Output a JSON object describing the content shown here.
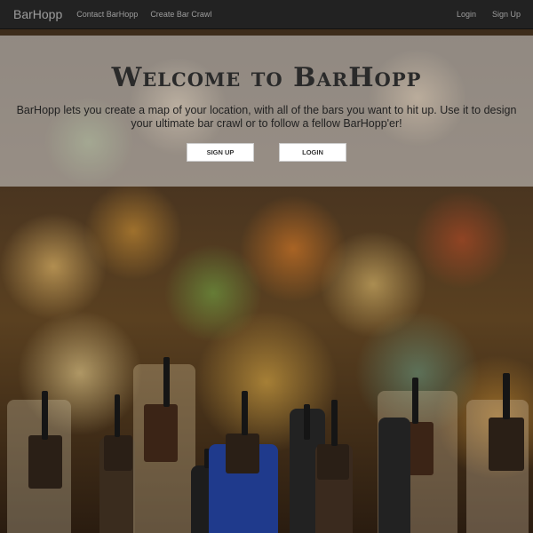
{
  "navbar": {
    "brand": "BarHopp",
    "links": [
      "Contact BarHopp",
      "Create Bar Crawl"
    ],
    "right_links": [
      "Login",
      "Sign Up"
    ]
  },
  "hero": {
    "title": "Welcome to BarHopp",
    "description": "BarHopp lets you create a map of your location, with all of the bars you want to hit up. Use it to design your ultimate bar crawl or to follow a fellow BarHopp'er!",
    "buttons": {
      "signup": "SIGN UP",
      "login": "LOGIN"
    }
  }
}
